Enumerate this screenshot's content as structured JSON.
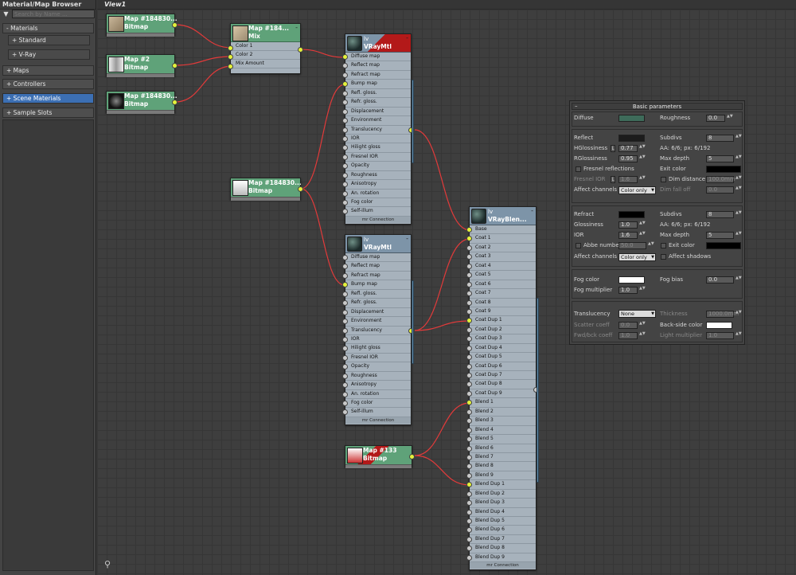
{
  "browser": {
    "title": "Material/Map Browser",
    "search_placeholder": "Search by Name ...",
    "rollouts": [
      {
        "label": "- Materials"
      },
      {
        "label": "+ Standard"
      },
      {
        "label": "+ V-Ray"
      },
      {
        "label": "+ Maps"
      },
      {
        "label": "+ Controllers"
      },
      {
        "label": "+ Scene Materials"
      },
      {
        "label": "+ Sample Slots"
      }
    ]
  },
  "view": {
    "tab_label": "View1"
  },
  "nodes": {
    "map1": {
      "title": "Map #184830...",
      "type": "Bitmap"
    },
    "map2": {
      "title": "Map #2",
      "type": "Bitmap"
    },
    "map3": {
      "title": "Map #184830...",
      "type": "Bitmap"
    },
    "map4": {
      "title": "Map #184830...",
      "type": "Bitmap"
    },
    "map5": {
      "title": "Map #133",
      "type": "Bitmap"
    },
    "mix": {
      "title": "Map #184...",
      "type": "Mix",
      "slots": [
        "Color 1",
        "Color 2",
        "Mix Amount"
      ]
    },
    "vraymtl1": {
      "title": "lv",
      "type": "VRayMtl"
    },
    "vraymtl2": {
      "title": "lv",
      "type": "VRayMtl"
    },
    "blend": {
      "title": "lv",
      "type": "VRayBlen..."
    },
    "mtl_slots": [
      "Diffuse map",
      "Reflect map",
      "Refract map",
      "Bump map",
      "Refl. gloss.",
      "Refr. gloss.",
      "Displacement",
      "Environment",
      "Translucency",
      "IOR",
      "Hilight gloss",
      "Fresnel IOR",
      "Opacity",
      "Roughness",
      "Anisotropy",
      "An. rotation",
      "Fog color",
      "Self-illum"
    ],
    "blend_slots": [
      "Base",
      "Coat 1",
      "Coat 2",
      "Coat 3",
      "Coat 4",
      "Coat 5",
      "Coat 6",
      "Coat 7",
      "Coat 8",
      "Coat 9",
      "Coat Dup 1",
      "Coat Dup 2",
      "Coat Dup 3",
      "Coat Dup 4",
      "Coat Dup 5",
      "Coat Dup 6",
      "Coat Dup 7",
      "Coat Dup 8",
      "Coat Dup 9",
      "Blend 1",
      "Blend 2",
      "Blend 3",
      "Blend 4",
      "Blend 5",
      "Blend 6",
      "Blend 7",
      "Blend 8",
      "Blend 9",
      "Blend Dup 1",
      "Blend Dup 2",
      "Blend Dup 3",
      "Blend Dup 4",
      "Blend Dup 5",
      "Blend Dup 6",
      "Blend Dup 7",
      "Blend Dup 8",
      "Blend Dup 9"
    ],
    "footer": "mr Connection",
    "minus": "-"
  },
  "params": {
    "title": "Basic parameters",
    "diffuse_label": "Diffuse",
    "roughness_label": "Roughness",
    "roughness_value": "0.0",
    "reflect_label": "Reflect",
    "subdivs_label": "Subdivs",
    "reflect_subdivs": "8",
    "hgloss_label": "HGlossiness",
    "l_btn": "L",
    "hgloss_value": "0.77",
    "aa_text": "AA: 6/6; px: 6/192",
    "rgloss_label": "RGlossiness",
    "rgloss_value": "0.95",
    "max_depth_label": "Max depth",
    "reflect_depth": "5",
    "fresnel_label": "Fresnel reflections",
    "exit_color_label": "Exit color",
    "fresnel_ior_label": "Fresnel IOR",
    "fresnel_ior_value": "1.6",
    "dim_distance_label": "Dim distance",
    "dim_distance_value": "100.0mm",
    "affect_channels_label": "Affect channels",
    "affect_channels_value": "Color only",
    "dim_falloff_label": "Dim fall off",
    "dim_falloff_value": "0.0",
    "refract_label": "Refract",
    "refract_subdivs": "8",
    "glossiness_label": "Glossiness",
    "glossiness_value": "1.0",
    "ior_label": "IOR",
    "ior_value": "1.6",
    "refract_depth": "5",
    "abbe_label": "Abbe number",
    "abbe_value": "50.0",
    "affect_shadows_label": "Affect shadows",
    "fog_color_label": "Fog color",
    "fog_bias_label": "Fog bias",
    "fog_bias_value": "0.0",
    "fog_mult_label": "Fog multiplier",
    "fog_mult_value": "1.0",
    "translucency_label": "Translucency",
    "translucency_value": "None",
    "thickness_label": "Thickness",
    "thickness_value": "1000.0mm",
    "scatter_label": "Scatter coeff",
    "scatter_value": "0.0",
    "backside_label": "Back-side color",
    "fwd_label": "Fwd/bck coeff",
    "fwd_value": "1.0",
    "light_mult_label": "Light multiplier",
    "light_mult_value": "1.0",
    "spin_glyph": "▲▼",
    "dd_glyph": "▼",
    "colors": {
      "diffuse": "#3e6b5a",
      "reflect": "#1c1c1c",
      "exit": "#000000",
      "refract": "#000000",
      "fog": "#ffffff",
      "backside": "#ffffff"
    }
  }
}
